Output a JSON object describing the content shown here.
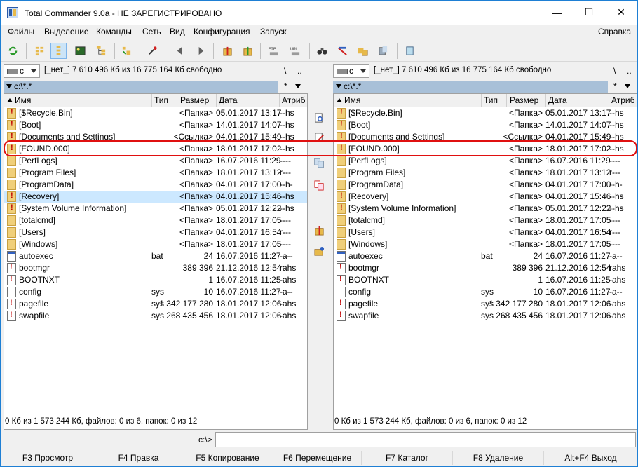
{
  "window": {
    "title": "Total Commander 9.0a - НЕ ЗАРЕГИСТРИРОВАНО",
    "minimize": "—",
    "maximize": "☐",
    "close": "✕"
  },
  "menu": {
    "items": [
      "Файлы",
      "Выделение",
      "Команды",
      "Сеть",
      "Вид",
      "Конфигурация",
      "Запуск"
    ],
    "help": "Справка"
  },
  "toolbar": {
    "icons": [
      "refresh-icon",
      "brief-view-icon",
      "full-view-icon",
      "thumbnails-icon",
      "tree-icon",
      "invert-selection-icon",
      "compare-icon",
      "back-icon",
      "forward-icon",
      "pack-icon",
      "unpack-icon",
      "ftp-icon",
      "url-icon",
      "find-icon",
      "multi-rename-icon",
      "sync-dirs-icon",
      "notepad-icon"
    ],
    "ftp_label": "FTP",
    "url_label": "URL"
  },
  "left": {
    "drive": "c",
    "drive_info": "[_нет_]  7 610 496 Кб из 16 775 164 Кб свободно",
    "root": "\\",
    "up": "..",
    "path": "c:\\*.*",
    "path_star": "*",
    "columns": [
      "Имя",
      "Тип",
      "Размер",
      "Дата",
      "Атриб"
    ],
    "rows": [
      {
        "icon": "warn",
        "name": "[$Recycle.Bin]",
        "type": "",
        "size": "<Папка>",
        "date": "05.01.2017 13:17",
        "attr": "--hs"
      },
      {
        "icon": "warn",
        "name": "[Boot]",
        "type": "",
        "size": "<Папка>",
        "date": "14.01.2017 14:07",
        "attr": "--hs"
      },
      {
        "icon": "warn",
        "name": "[Documents and Settings]",
        "type": "",
        "size": "<Ссылка>",
        "date": "04.01.2017 15:49",
        "attr": "--hs"
      },
      {
        "icon": "warn",
        "name": "[FOUND.000]",
        "type": "",
        "size": "<Папка>",
        "date": "18.01.2017 17:02",
        "attr": "--hs"
      },
      {
        "icon": "folder",
        "name": "[PerfLogs]",
        "type": "",
        "size": "<Папка>",
        "date": "16.07.2016 11:29",
        "attr": "----"
      },
      {
        "icon": "folder",
        "name": "[Program Files]",
        "type": "",
        "size": "<Папка>",
        "date": "18.01.2017 13:12",
        "attr": "r---"
      },
      {
        "icon": "folder",
        "name": "[ProgramData]",
        "type": "",
        "size": "<Папка>",
        "date": "04.01.2017 17:00",
        "attr": "--h-"
      },
      {
        "icon": "warn",
        "name": "[Recovery]",
        "type": "",
        "size": "<Папка>",
        "date": "04.01.2017 15:46",
        "attr": "--hs",
        "selected": true
      },
      {
        "icon": "warn",
        "name": "[System Volume Information]",
        "type": "",
        "size": "<Папка>",
        "date": "05.01.2017 12:22",
        "attr": "--hs"
      },
      {
        "icon": "folder",
        "name": "[totalcmd]",
        "type": "",
        "size": "<Папка>",
        "date": "18.01.2017 17:05",
        "attr": "----"
      },
      {
        "icon": "folder",
        "name": "[Users]",
        "type": "",
        "size": "<Папка>",
        "date": "04.01.2017 16:54",
        "attr": "r---"
      },
      {
        "icon": "folder",
        "name": "[Windows]",
        "type": "",
        "size": "<Папка>",
        "date": "18.01.2017 17:05",
        "attr": "----"
      },
      {
        "icon": "bat",
        "name": "autoexec",
        "type": "bat",
        "size": "24",
        "date": "16.07.2016 11:27",
        "attr": "-a--"
      },
      {
        "icon": "docwarn",
        "name": "bootmgr",
        "type": "",
        "size": "389 396",
        "date": "21.12.2016 12:54",
        "attr": "rahs"
      },
      {
        "icon": "docwarn",
        "name": "BOOTNXT",
        "type": "",
        "size": "1",
        "date": "16.07.2016 11:25",
        "attr": "-ahs"
      },
      {
        "icon": "doc",
        "name": "config",
        "type": "sys",
        "size": "10",
        "date": "16.07.2016 11:27",
        "attr": "-a--"
      },
      {
        "icon": "docwarn",
        "name": "pagefile",
        "type": "sys",
        "size": "1 342 177 280",
        "date": "18.01.2017 12:06",
        "attr": "-ahs"
      },
      {
        "icon": "docwarn",
        "name": "swapfile",
        "type": "sys",
        "size": "268 435 456",
        "date": "18.01.2017 12:06",
        "attr": "-ahs"
      }
    ],
    "status": "0 Кб из 1 573 244 Кб, файлов: 0 из 6, папок: 0 из 12"
  },
  "right": {
    "drive": "c",
    "drive_info": "[_нет_]  7 610 496 Кб из 16 775 164 Кб свободно",
    "root": "\\",
    "up": "..",
    "path": "c:\\*.*",
    "path_star": "*",
    "columns": [
      "Имя",
      "Тип",
      "Размер",
      "Дата",
      "Атриб"
    ],
    "rows": [
      {
        "icon": "warn",
        "name": "[$Recycle.Bin]",
        "type": "",
        "size": "<Папка>",
        "date": "05.01.2017 13:17",
        "attr": "--hs"
      },
      {
        "icon": "warn",
        "name": "[Boot]",
        "type": "",
        "size": "<Папка>",
        "date": "14.01.2017 14:07",
        "attr": "--hs"
      },
      {
        "icon": "warn",
        "name": "[Documents and Settings]",
        "type": "",
        "size": "<Ссылка>",
        "date": "04.01.2017 15:49",
        "attr": "--hs"
      },
      {
        "icon": "warn",
        "name": "[FOUND.000]",
        "type": "",
        "size": "<Папка>",
        "date": "18.01.2017 17:02",
        "attr": "--hs"
      },
      {
        "icon": "folder",
        "name": "[PerfLogs]",
        "type": "",
        "size": "<Папка>",
        "date": "16.07.2016 11:29",
        "attr": "----"
      },
      {
        "icon": "folder",
        "name": "[Program Files]",
        "type": "",
        "size": "<Папка>",
        "date": "18.01.2017 13:12",
        "attr": "r---"
      },
      {
        "icon": "folder",
        "name": "[ProgramData]",
        "type": "",
        "size": "<Папка>",
        "date": "04.01.2017 17:00",
        "attr": "--h-"
      },
      {
        "icon": "warn",
        "name": "[Recovery]",
        "type": "",
        "size": "<Папка>",
        "date": "04.01.2017 15:46",
        "attr": "--hs"
      },
      {
        "icon": "warn",
        "name": "[System Volume Information]",
        "type": "",
        "size": "<Папка>",
        "date": "05.01.2017 12:22",
        "attr": "--hs"
      },
      {
        "icon": "folder",
        "name": "[totalcmd]",
        "type": "",
        "size": "<Папка>",
        "date": "18.01.2017 17:05",
        "attr": "----"
      },
      {
        "icon": "folder",
        "name": "[Users]",
        "type": "",
        "size": "<Папка>",
        "date": "04.01.2017 16:54",
        "attr": "r---"
      },
      {
        "icon": "folder",
        "name": "[Windows]",
        "type": "",
        "size": "<Папка>",
        "date": "18.01.2017 17:05",
        "attr": "----"
      },
      {
        "icon": "bat",
        "name": "autoexec",
        "type": "bat",
        "size": "24",
        "date": "16.07.2016 11:27",
        "attr": "-a--"
      },
      {
        "icon": "docwarn",
        "name": "bootmgr",
        "type": "",
        "size": "389 396",
        "date": "21.12.2016 12:54",
        "attr": "rahs"
      },
      {
        "icon": "docwarn",
        "name": "BOOTNXT",
        "type": "",
        "size": "1",
        "date": "16.07.2016 11:25",
        "attr": "-ahs"
      },
      {
        "icon": "doc",
        "name": "config",
        "type": "sys",
        "size": "10",
        "date": "16.07.2016 11:27",
        "attr": "-a--"
      },
      {
        "icon": "docwarn",
        "name": "pagefile",
        "type": "sys",
        "size": "1 342 177 280",
        "date": "18.01.2017 12:06",
        "attr": "-ahs"
      },
      {
        "icon": "docwarn",
        "name": "swapfile",
        "type": "sys",
        "size": "268 435 456",
        "date": "18.01.2017 12:06",
        "attr": "-ahs"
      }
    ],
    "status": "0 Кб из 1 573 244 Кб, файлов: 0 из 6, папок: 0 из 12"
  },
  "middle_buttons": [
    "view-icon",
    "edit-icon",
    "copy-icon",
    "move-icon",
    "pack-icon",
    "new-folder-icon"
  ],
  "cmdline": {
    "label": "c:\\>",
    "value": ""
  },
  "fkeys": [
    "F3 Просмотр",
    "F4 Правка",
    "F5 Копирование",
    "F6 Перемещение",
    "F7 Каталог",
    "F8 Удаление",
    "Alt+F4 Выход"
  ],
  "colors": {
    "selection": "#cce8ff",
    "path_bar": "#a8c0d8",
    "highlight": "#e01010",
    "window_border": "#1e7fd4"
  }
}
